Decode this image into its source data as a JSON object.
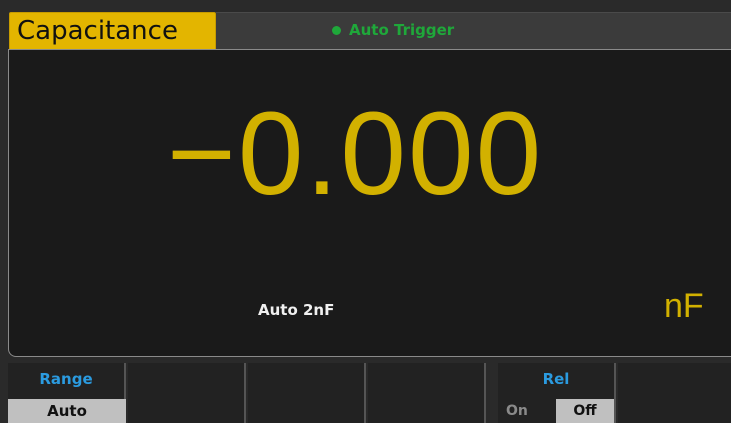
{
  "header": {
    "mode_tab": "Capacitance",
    "trigger_status": "Auto Trigger"
  },
  "measurement": {
    "reading": "−0.000",
    "range": "Auto  2nF",
    "unit": "nF"
  },
  "softkeys": [
    {
      "title": "Range",
      "value": "Auto"
    },
    {
      "title": "",
      "value": ""
    },
    {
      "title": "",
      "value": ""
    },
    {
      "title": "",
      "value": ""
    },
    {
      "title": "Rel",
      "options": [
        "On",
        "Off"
      ],
      "selected": "Off"
    },
    {
      "title": "",
      "value": ""
    }
  ],
  "colors": {
    "accent_yellow": "#d2b100",
    "tab_yellow": "#e3b500",
    "trigger_green": "#1fa83a",
    "softkey_title_blue": "#2b9be0"
  }
}
